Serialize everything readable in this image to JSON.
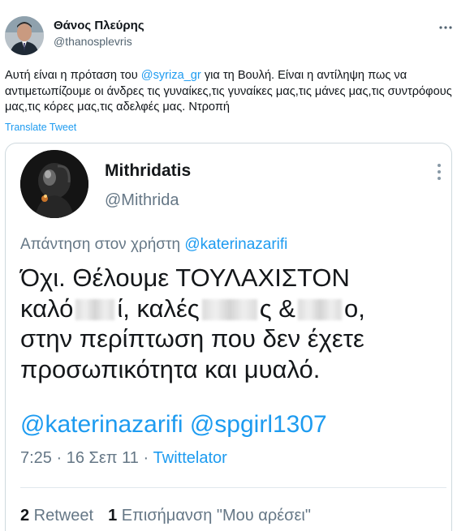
{
  "author": {
    "name": "Θάνος Πλεύρης",
    "handle": "@thanosplevris"
  },
  "tweet": {
    "part1": "Αυτή είναι η πρόταση του ",
    "mention": "@syriza_gr",
    "part2": " για τη Βουλή. Είναι η αντίληψη πως να αντιμετωπίζουμε οι άνδρες τις γυναίκες,τις γυναίκες μας,τις μάνες μας,τις συντρόφους μας,τις κόρες μας,τις αδελφές μας. Ντροπή",
    "translate_label": "Translate Tweet"
  },
  "embedded": {
    "name": "Mithridatis",
    "handle": "@Mithrida",
    "reply_prefix": "Απάντηση στον χρήστη ",
    "reply_mention": "@katerinazarifi",
    "line1": "Όχι. Θέλουμε ΤΟΥΛΑΧΙΣΤΟΝ",
    "line2_a": "καλό",
    "line2_b": "ί, καλές",
    "line2_c": "ς &",
    "line2_d": "ο,",
    "line3": "στην περίπτωση που δεν έχετε",
    "line4": "προσωπικότητα και μυαλό.",
    "mentions_line": "@katerinazarifi @spgirl1307",
    "time": "7:25 · 16 Σεπ 11 · ",
    "app": "Twittelator",
    "retweet_count": "2",
    "retweet_label": " Retweet",
    "like_count": "1",
    "like_label": " Επισήμανση \"Μου αρέσει\""
  },
  "icons": {
    "top_more": "more-horizontal-icon",
    "embed_more": "more-vertical-icon"
  },
  "colors": {
    "link": "#1d9bf0",
    "muted": "#536471",
    "embed_muted": "#657786"
  }
}
